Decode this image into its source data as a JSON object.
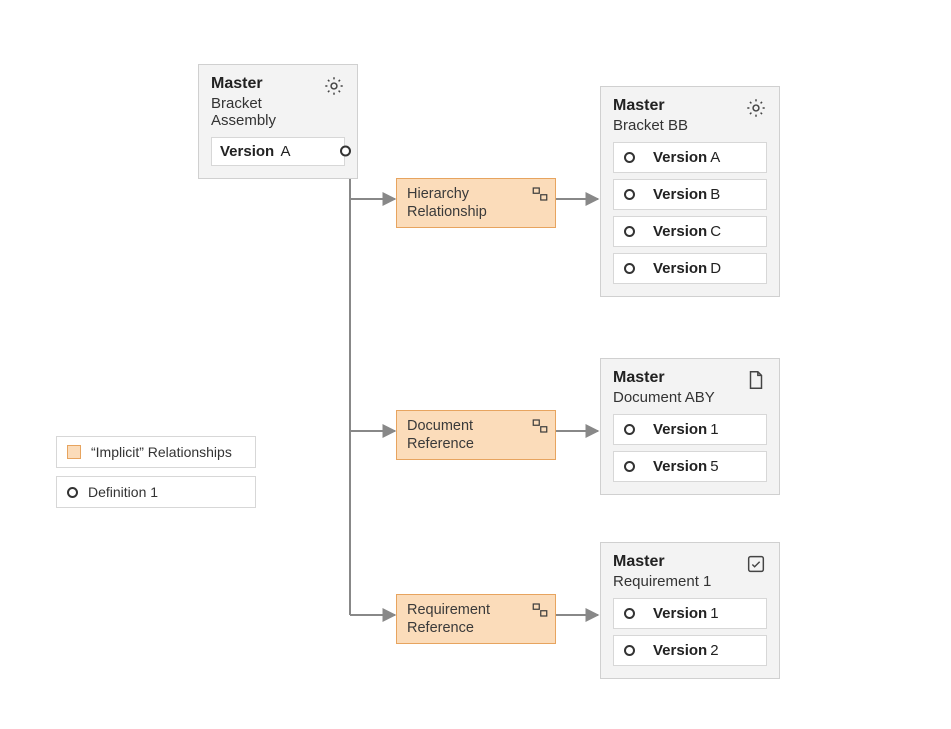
{
  "source": {
    "title": "Master",
    "subtitle": "Bracket Assembly",
    "version_label": "Version",
    "version_value": "A"
  },
  "relationships": [
    {
      "line1": "Hierarchy",
      "line2": "Relationship"
    },
    {
      "line1": "Document",
      "line2": "Reference"
    },
    {
      "line1": "Requirement",
      "line2": "Reference"
    }
  ],
  "targets": [
    {
      "title": "Master",
      "subtitle": "Bracket BB",
      "icon": "gear",
      "versions": [
        {
          "label": "Version",
          "value": "A"
        },
        {
          "label": "Version",
          "value": "B"
        },
        {
          "label": "Version",
          "value": "C"
        },
        {
          "label": "Version",
          "value": "D"
        }
      ]
    },
    {
      "title": "Master",
      "subtitle": "Document ABY",
      "icon": "document",
      "versions": [
        {
          "label": "Version",
          "value": "1"
        },
        {
          "label": "Version",
          "value": "5"
        }
      ]
    },
    {
      "title": "Master",
      "subtitle": "Requirement 1",
      "icon": "check",
      "versions": [
        {
          "label": "Version",
          "value": "1"
        },
        {
          "label": "Version",
          "value": "2"
        }
      ]
    }
  ],
  "legend": {
    "implicit": "“Implicit” Relationships",
    "definition": "Definition 1"
  }
}
